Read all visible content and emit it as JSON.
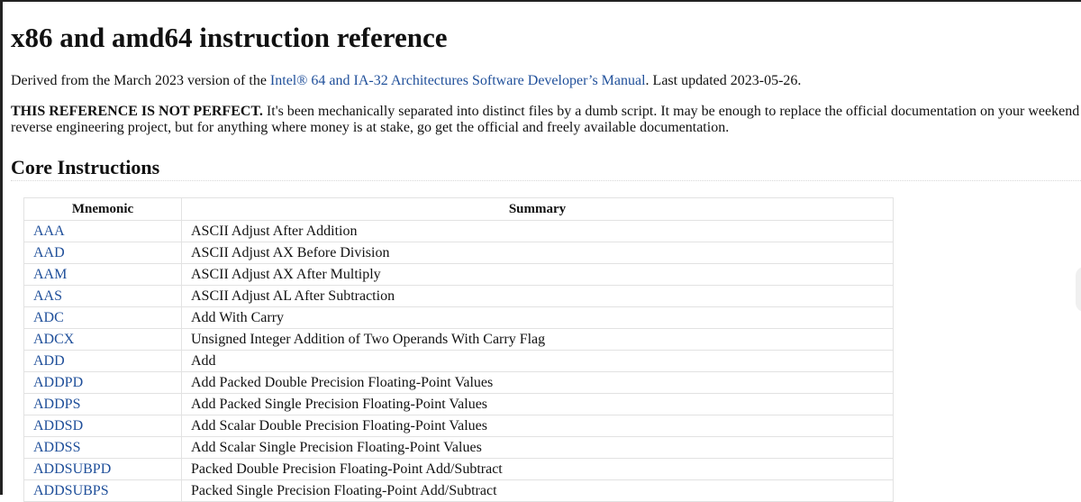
{
  "page": {
    "title": "x86 and amd64 instruction reference",
    "intro_prefix": "Derived from the March 2023 version of the ",
    "intro_link": "Intel® 64 and IA-32 Architectures Software Developer’s Manual",
    "intro_suffix": ". Last updated 2023-05-26.",
    "warning_bold": "THIS REFERENCE IS NOT PERFECT.",
    "warning_text": " It's been mechanically separated into distinct files by a dumb script. It may be enough to replace the official documentation on your weekend reverse engineering project, but for anything where money is at stake, go get the official and freely available documentation.",
    "section_title": "Core Instructions"
  },
  "table": {
    "headers": {
      "mnemonic": "Mnemonic",
      "summary": "Summary"
    },
    "rows": [
      {
        "mnemonic": "AAA",
        "summary": "ASCII Adjust After Addition"
      },
      {
        "mnemonic": "AAD",
        "summary": "ASCII Adjust AX Before Division"
      },
      {
        "mnemonic": "AAM",
        "summary": "ASCII Adjust AX After Multiply"
      },
      {
        "mnemonic": "AAS",
        "summary": "ASCII Adjust AL After Subtraction"
      },
      {
        "mnemonic": "ADC",
        "summary": "Add With Carry"
      },
      {
        "mnemonic": "ADCX",
        "summary": "Unsigned Integer Addition of Two Operands With Carry Flag"
      },
      {
        "mnemonic": "ADD",
        "summary": "Add"
      },
      {
        "mnemonic": "ADDPD",
        "summary": "Add Packed Double Precision Floating-Point Values"
      },
      {
        "mnemonic": "ADDPS",
        "summary": "Add Packed Single Precision Floating-Point Values"
      },
      {
        "mnemonic": "ADDSD",
        "summary": "Add Scalar Double Precision Floating-Point Values"
      },
      {
        "mnemonic": "ADDSS",
        "summary": "Add Scalar Single Precision Floating-Point Values"
      },
      {
        "mnemonic": "ADDSUBPD",
        "summary": "Packed Double Precision Floating-Point Add/Subtract"
      },
      {
        "mnemonic": "ADDSUBPS",
        "summary": "Packed Single Precision Floating-Point Add/Subtract"
      }
    ]
  },
  "colors": {
    "link": "#1f4f9a",
    "border": "#e2e2e2"
  }
}
